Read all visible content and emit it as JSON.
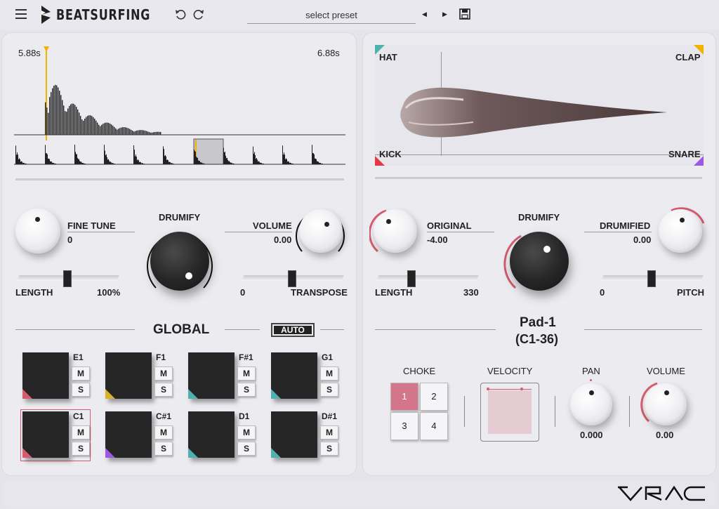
{
  "header": {
    "app_name": "BEATSURFING",
    "preset_label": "select preset"
  },
  "waveform": {
    "start_time": "5.88s",
    "end_time": "6.88s"
  },
  "left": {
    "fine_tune": {
      "label": "FINE TUNE",
      "value": "0"
    },
    "drumify_label": "DRUMIFY",
    "volume": {
      "label": "VOLUME",
      "value": "0.00"
    },
    "length": {
      "label": "LENGTH",
      "value": "100%"
    },
    "transpose": {
      "label": "TRANSPOSE",
      "value": "0"
    },
    "section_title": "GLOBAL",
    "auto_label": "AUTO",
    "pads": [
      {
        "note": "E1",
        "m": "M",
        "s": "S",
        "color": "#d45c6e"
      },
      {
        "note": "F1",
        "m": "M",
        "s": "S",
        "color": "#d9b02d"
      },
      {
        "note": "F#1",
        "m": "M",
        "s": "S",
        "color": "#4fb0b0"
      },
      {
        "note": "G1",
        "m": "M",
        "s": "S",
        "color": "#4fb0b0"
      },
      {
        "note": "C1",
        "m": "M",
        "s": "S",
        "color": "#d45c6e"
      },
      {
        "note": "C#1",
        "m": "M",
        "s": "S",
        "color": "#9b59e6"
      },
      {
        "note": "D1",
        "m": "M",
        "s": "S",
        "color": "#4fb0b0"
      },
      {
        "note": "D#1",
        "m": "M",
        "s": "S",
        "color": "#4fb0b0"
      }
    ]
  },
  "right": {
    "xy_labels": {
      "hat": "HAT",
      "clap": "CLAP",
      "kick": "KICK",
      "snare": "SNARE"
    },
    "xy_colors": {
      "hat": "#4fb0b0",
      "clap": "#f0b400",
      "kick": "#e63946",
      "snare": "#9b59e6"
    },
    "original": {
      "label": "ORIGINAL",
      "value": "-4.00"
    },
    "drumify_label": "DRUMIFY",
    "drumified": {
      "label": "DRUMIFIED",
      "value": "0.00"
    },
    "length": {
      "label": "LENGTH",
      "value": "330"
    },
    "pitch": {
      "label": "PITCH",
      "value": "0"
    },
    "pad_name": "Pad-1",
    "pad_range": "(C1-36)",
    "choke": {
      "label": "CHOKE",
      "buttons": [
        "1",
        "2",
        "3",
        "4"
      ],
      "active": "1"
    },
    "velocity_label": "VELOCITY",
    "pan": {
      "label": "PAN",
      "value": "0.000"
    },
    "volume": {
      "label": "VOLUME",
      "value": "0.00"
    }
  },
  "colors": {
    "accent": "#d45c6e",
    "panel": "#ebebf0"
  }
}
